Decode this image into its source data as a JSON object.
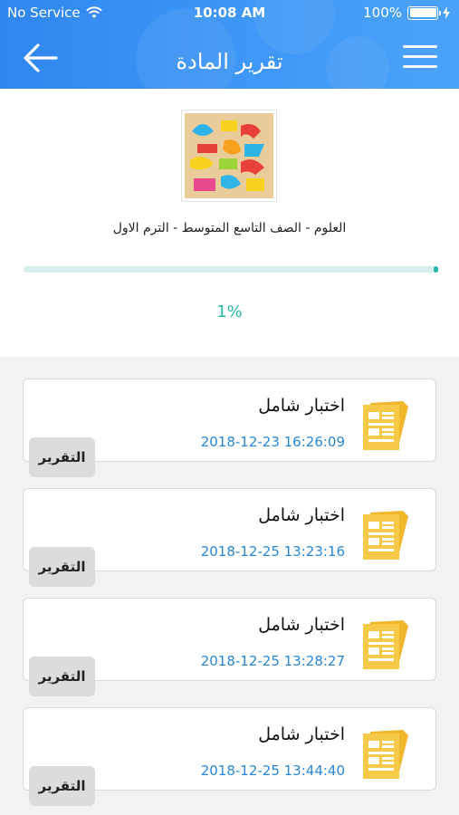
{
  "status_bar": {
    "carrier": "No Service",
    "time": "10:08 AM",
    "battery": "100%"
  },
  "navbar": {
    "title": "تقرير المادة",
    "back_icon": "arrow-left-icon",
    "menu_icon": "hamburger-menu-icon"
  },
  "subject": {
    "name": "العلوم - الصف التاسع المتوسط - الترم الاول",
    "progress_text": "1%",
    "progress_value": 0.01,
    "image_icon": "colorful-letters-image"
  },
  "exams": [
    {
      "title": "اختبار شامل",
      "date": "2018-12-23 16:26:09",
      "button": "التقرير"
    },
    {
      "title": "اختبار شامل",
      "date": "2018-12-25 13:23:16",
      "button": "التقرير"
    },
    {
      "title": "اختبار شامل",
      "date": "2018-12-25 13:28:27",
      "button": "التقرير"
    },
    {
      "title": "اختبار شامل",
      "date": "2018-12-25 13:44:40",
      "button": "التقرير"
    }
  ],
  "colors": {
    "header": "#3f97f6",
    "accent": "#26b8ad",
    "date": "#2a87d8",
    "exam_icon": "#f7c948"
  }
}
